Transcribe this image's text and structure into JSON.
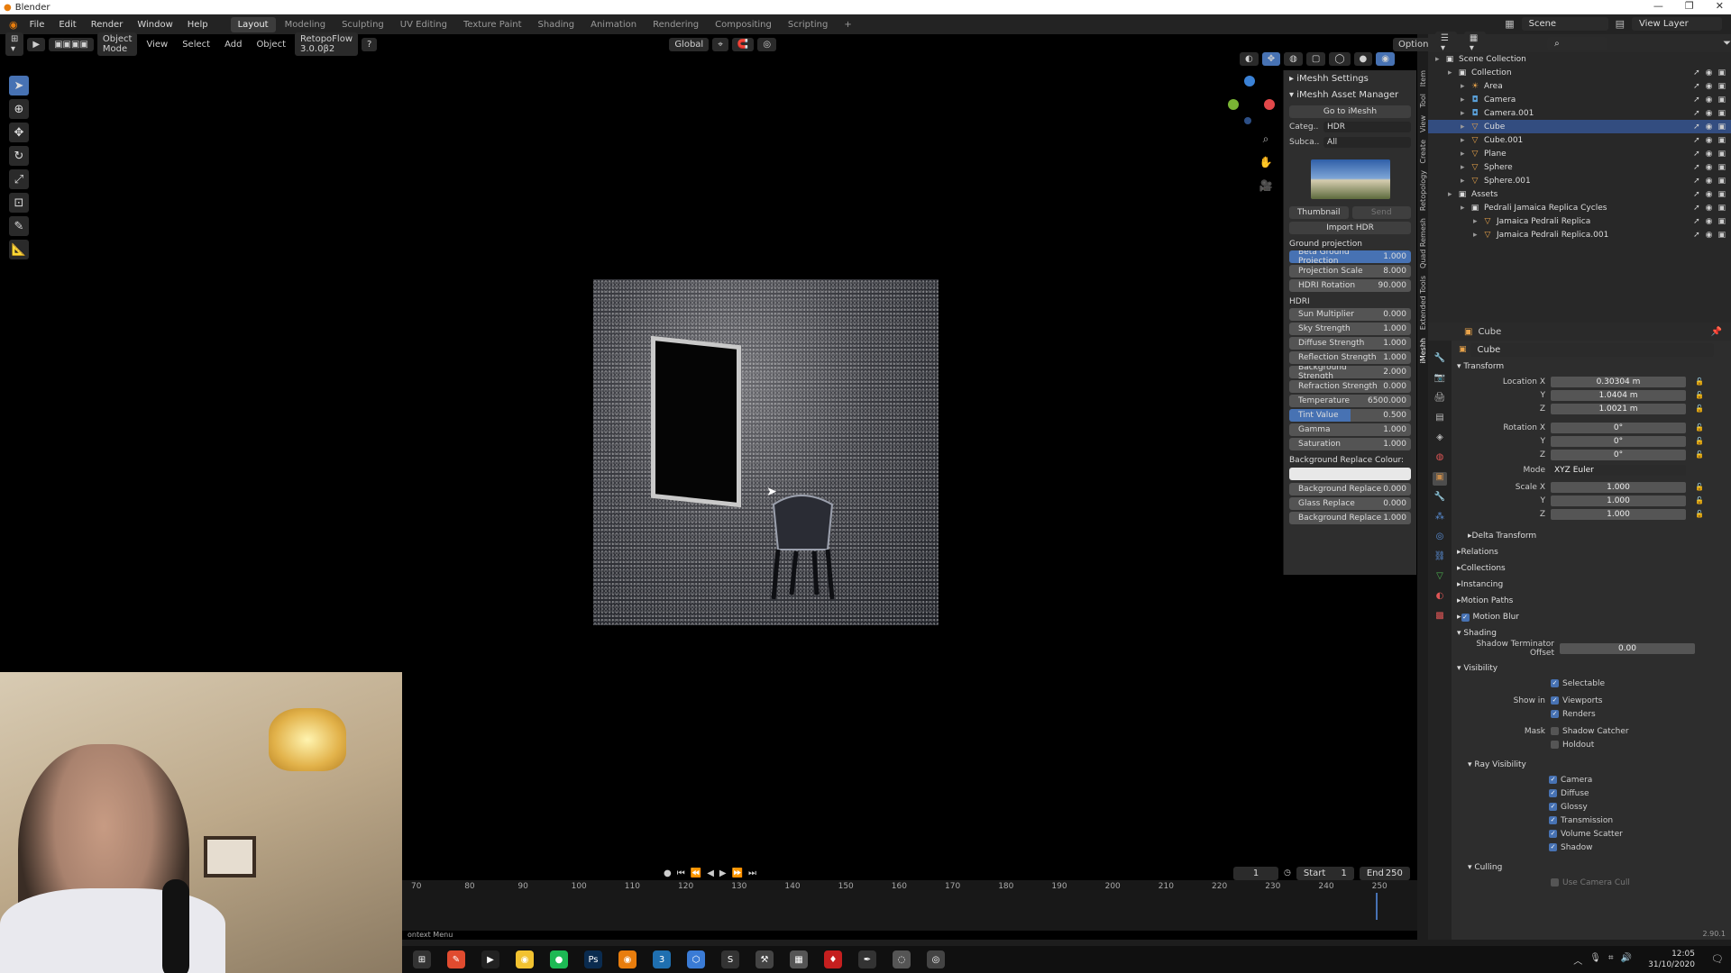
{
  "titlebar": {
    "title": "Blender"
  },
  "menubar": {
    "menus": [
      "File",
      "Edit",
      "Render",
      "Window",
      "Help"
    ],
    "workspaces": [
      "Layout",
      "Modeling",
      "Sculpting",
      "UV Editing",
      "Texture Paint",
      "Shading",
      "Animation",
      "Rendering",
      "Compositing",
      "Scripting"
    ],
    "active_workspace": "Layout",
    "add_tab": "+",
    "scene": "Scene",
    "view_layer": "View Layer"
  },
  "viewport": {
    "mode": "Object Mode",
    "view": "View",
    "select": "Select",
    "add": "Add",
    "object": "Object",
    "addon": "RetopoFlow 3.0.0β2",
    "orientation": "Global",
    "options": "Options"
  },
  "imeshh": {
    "settings_title": "iMeshh Settings",
    "asset_manager_title": "iMeshh Asset Manager",
    "go_to": "Go to iMeshh",
    "category_label": "Categ..",
    "category_value": "HDR",
    "subcategory_label": "Subca..",
    "subcategory_value": "All",
    "thumbnail_btn": "Thumbnail",
    "send_btn": "Send",
    "import_btn": "Import HDR",
    "ground_projection_title": "Ground projection",
    "ground_sliders": [
      {
        "label": "Beta Ground Projection",
        "value": "1.000",
        "active": true
      },
      {
        "label": "Projection Scale",
        "value": "8.000"
      },
      {
        "label": "HDRI Rotation",
        "value": "90.000"
      }
    ],
    "hdri_title": "HDRI",
    "hdri_sliders": [
      {
        "label": "Sun Multiplier",
        "value": "0.000"
      },
      {
        "label": "Sky Strength",
        "value": "1.000"
      },
      {
        "label": "Diffuse Strength",
        "value": "1.000"
      },
      {
        "label": "Reflection Strength",
        "value": "1.000"
      },
      {
        "label": "Background Strength",
        "value": "2.000"
      },
      {
        "label": "Refraction Strength",
        "value": "0.000"
      },
      {
        "label": "Temperature",
        "value": "6500.000"
      },
      {
        "label": "Tint Value",
        "value": "0.500",
        "fill": 0.5
      },
      {
        "label": "Gamma",
        "value": "1.000"
      },
      {
        "label": "Saturation",
        "value": "1.000"
      }
    ],
    "bg_replace_colour_title": "Background Replace Colour:",
    "replace_sliders": [
      {
        "label": "Background Replace",
        "value": "0.000"
      },
      {
        "label": "Glass Replace",
        "value": "0.000"
      },
      {
        "label": "Background Replace",
        "value": "1.000"
      }
    ]
  },
  "vtabs": [
    "Item",
    "Tool",
    "View",
    "Create",
    "Retopology",
    "Quad Remesh",
    "Extended Tools",
    "iMeshh"
  ],
  "timeline": {
    "current_frame": "1",
    "start_label": "Start",
    "start_value": "1",
    "end_label": "End",
    "end_value": "250",
    "ticks": [
      "70",
      "80",
      "90",
      "100",
      "110",
      "120",
      "130",
      "140",
      "150",
      "160",
      "170",
      "180",
      "190",
      "200",
      "210",
      "220",
      "230",
      "240",
      "250"
    ],
    "status": "ontext Menu"
  },
  "outliner": {
    "rows": [
      {
        "label": "Scene Collection",
        "depth": 0,
        "icon": "▣"
      },
      {
        "label": "Collection",
        "depth": 1,
        "icon": "▣"
      },
      {
        "label": "Area",
        "depth": 2,
        "icon": "☀"
      },
      {
        "label": "Camera",
        "depth": 2,
        "icon": "◘"
      },
      {
        "label": "Camera.001",
        "depth": 2,
        "icon": "◘"
      },
      {
        "label": "Cube",
        "depth": 2,
        "icon": "▽",
        "selected": true
      },
      {
        "label": "Cube.001",
        "depth": 2,
        "icon": "▽"
      },
      {
        "label": "Plane",
        "depth": 2,
        "icon": "▽"
      },
      {
        "label": "Sphere",
        "depth": 2,
        "icon": "▽"
      },
      {
        "label": "Sphere.001",
        "depth": 2,
        "icon": "▽"
      },
      {
        "label": "Assets",
        "depth": 1,
        "icon": "▣"
      },
      {
        "label": "Pedrali Jamaica Replica Cycles",
        "depth": 2,
        "icon": "▣"
      },
      {
        "label": "Jamaica Pedrali Replica",
        "depth": 3,
        "icon": "▽"
      },
      {
        "label": "Jamaica Pedrali Replica.001",
        "depth": 3,
        "icon": "▽"
      }
    ]
  },
  "properties": {
    "object_name": "Cube",
    "name_field": "Cube",
    "transform_title": "Transform",
    "location": [
      {
        "label": "Location X",
        "value": "0.30304 m"
      },
      {
        "label": "Y",
        "value": "1.0404 m"
      },
      {
        "label": "Z",
        "value": "1.0021 m"
      }
    ],
    "rotation": [
      {
        "label": "Rotation X",
        "value": "0°"
      },
      {
        "label": "Y",
        "value": "0°"
      },
      {
        "label": "Z",
        "value": "0°"
      }
    ],
    "mode_label": "Mode",
    "mode_value": "XYZ Euler",
    "scale": [
      {
        "label": "Scale X",
        "value": "1.000"
      },
      {
        "label": "Y",
        "value": "1.000"
      },
      {
        "label": "Z",
        "value": "1.000"
      }
    ],
    "sections": [
      "Delta Transform",
      "Relations",
      "Collections",
      "Instancing",
      "Motion Paths",
      "Motion Blur"
    ],
    "shading_title": "Shading",
    "shadow_terminator_label": "Shadow Terminator Offset",
    "shadow_terminator_value": "0.00",
    "visibility_title": "Visibility",
    "selectable": "Selectable",
    "show_in_label": "Show in",
    "viewports": "Viewports",
    "renders": "Renders",
    "mask_label": "Mask",
    "shadow_catcher": "Shadow Catcher",
    "holdout": "Holdout",
    "ray_visibility_title": "Ray Visibility",
    "ray": [
      "Camera",
      "Diffuse",
      "Glossy",
      "Transmission",
      "Volume Scatter",
      "Shadow"
    ],
    "culling_title": "Culling",
    "use_camera_cull": "Use Camera Cull",
    "version": "2.90.1"
  },
  "taskbar": {
    "icons": [
      "start-icon",
      "blender-orange-icon",
      "terminal-icon",
      "chrome-icon",
      "spotify-icon",
      "photoshop-icon",
      "blender-icon",
      "app-3-icon",
      "box-icon",
      "steam-icon",
      "tool-icon",
      "cube-icon",
      "redshift-icon",
      "pen-icon",
      "unity-icon",
      "obs-icon"
    ],
    "time": "12:05",
    "date": "31/10/2020"
  }
}
